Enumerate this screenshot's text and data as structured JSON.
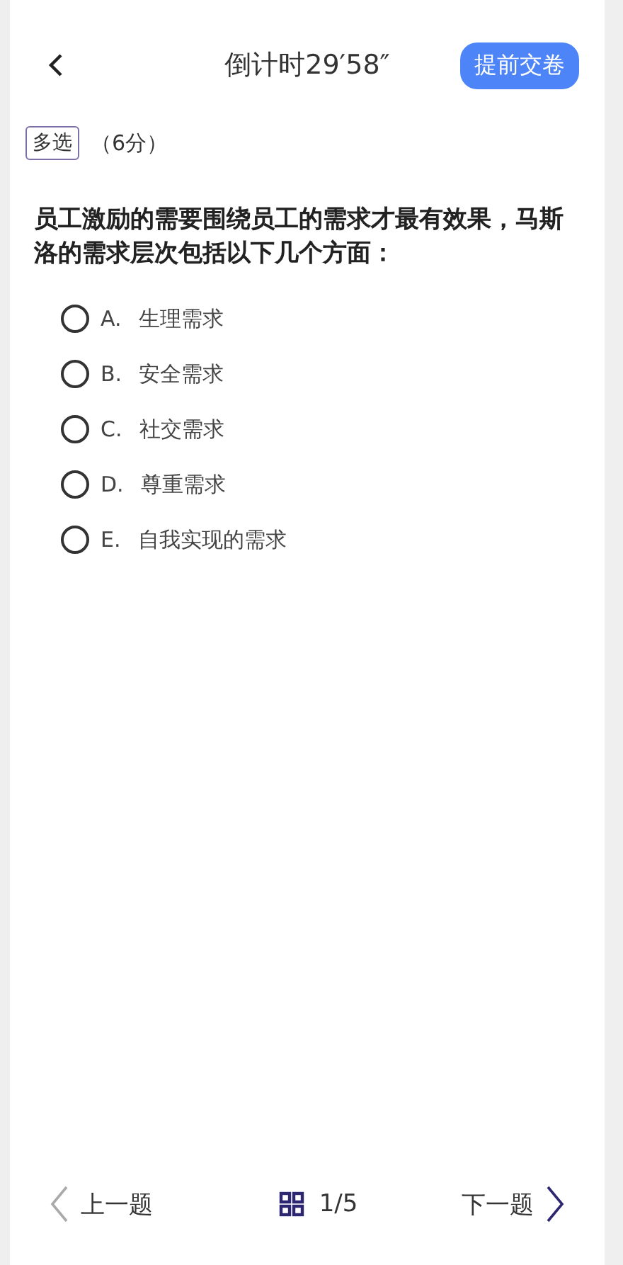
{
  "header": {
    "title": "倒计时29′58″",
    "submit_button": "提前交卷"
  },
  "question": {
    "type_tag": "多选",
    "score": "（6分）",
    "text": "员工激励的需要围绕员工的需求才最有效果，马斯洛的需求层次包括以下几个方面：",
    "options": [
      {
        "letter": "A.",
        "text": "生理需求",
        "selected": false
      },
      {
        "letter": "B.",
        "text": "安全需求",
        "selected": false
      },
      {
        "letter": "C.",
        "text": "社交需求",
        "selected": false
      },
      {
        "letter": "D.",
        "text": "尊重需求",
        "selected": false
      },
      {
        "letter": "E.",
        "text": "自我实现的需求",
        "selected": false
      }
    ]
  },
  "footer": {
    "prev": {
      "label": "上一题",
      "disabled": true
    },
    "progress": "1/5",
    "next": {
      "label": "下一题",
      "disabled": false
    }
  }
}
